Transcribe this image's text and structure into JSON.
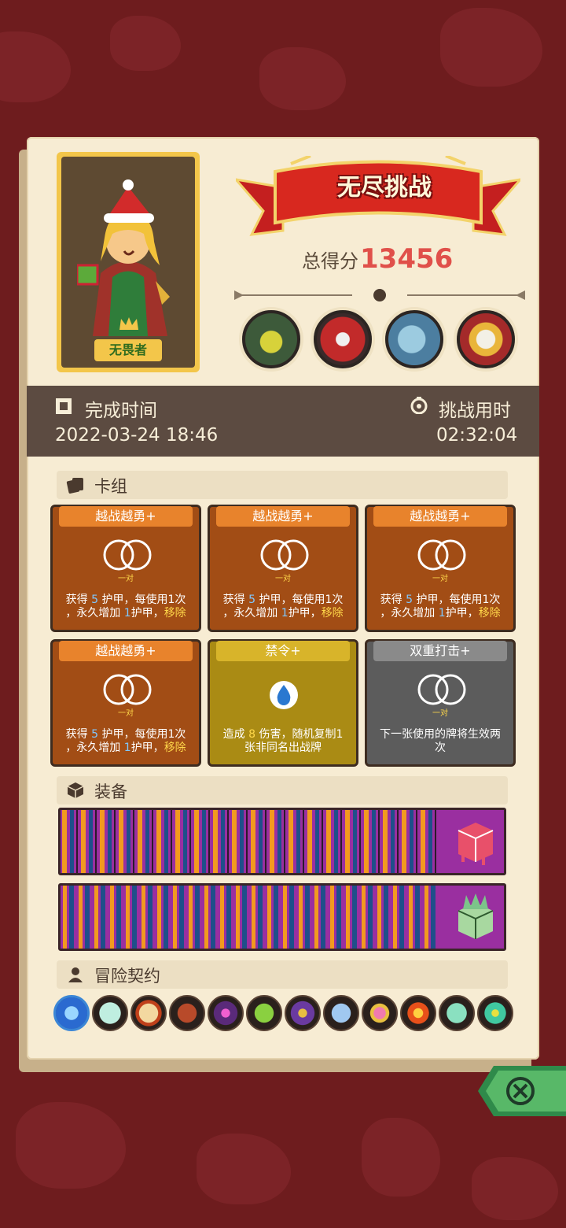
{
  "hero": {
    "name": "无畏者"
  },
  "banner": {
    "title": "无尽挑战"
  },
  "score": {
    "label": "总得分",
    "value": "13456"
  },
  "bosses": [
    "armored-knight-boss",
    "red-machine-boss",
    "blue-beast-boss",
    "skull-crown-boss"
  ],
  "time": {
    "finish_label": "完成时间",
    "finish_value": "2022-03-24 18:46",
    "elapsed_label": "挑战用时",
    "elapsed_value": "02:32:04"
  },
  "deck": {
    "title": "卡组",
    "cards": [
      {
        "title": "越战越勇+",
        "pair": "一对",
        "d1": "获得 ",
        "n1": "5",
        "d2": " 护甲，每使用1次",
        "d3": "，永久增加 ",
        "n2": "1",
        "d4": "护甲，",
        "d5": "移除"
      },
      {
        "title": "越战越勇+",
        "pair": "一对",
        "d1": "获得 ",
        "n1": "5",
        "d2": " 护甲，每使用1次",
        "d3": "，永久增加 ",
        "n2": "1",
        "d4": "护甲，",
        "d5": "移除"
      },
      {
        "title": "越战越勇+",
        "pair": "一对",
        "d1": "获得 ",
        "n1": "5",
        "d2": " 护甲，每使用1次",
        "d3": "，永久增加 ",
        "n2": "1",
        "d4": "护甲，",
        "d5": "移除"
      },
      {
        "title": "越战越勇+",
        "pair": "一对",
        "d1": "获得 ",
        "n1": "5",
        "d2": " 护甲，每使用1次",
        "d3": "，永久增加 ",
        "n2": "1",
        "d4": "护甲，",
        "d5": "移除"
      },
      {
        "title": "禁令+",
        "d1": "造成 ",
        "n1": "8",
        "d2": " 伤害，随机复制1",
        "d3": "张非同名出战牌"
      },
      {
        "title": "双重打击+",
        "pair": "一对",
        "d1": "下一张使用的牌将生效两",
        "d2": "次"
      }
    ]
  },
  "equipment": {
    "title": "装备",
    "items": [
      "red-slime-cube-icon",
      "green-crystal-cube-icon"
    ]
  },
  "contracts": {
    "title": "冒险契约",
    "items": [
      "blue-flame-skull-icon",
      "potion-bottle-icon",
      "gift-sack-icon",
      "horn-icon",
      "purple-eye-icon",
      "green-poison-icon",
      "dark-star-icon",
      "crystal-vial-icon",
      "pink-orb-icon",
      "fire-burst-icon",
      "teal-flask-icon",
      "green-splat-icon"
    ]
  },
  "colors": {
    "accent": "#e0504a",
    "bar_bg": "#5c4b41",
    "panel": "#f7ecd3"
  }
}
